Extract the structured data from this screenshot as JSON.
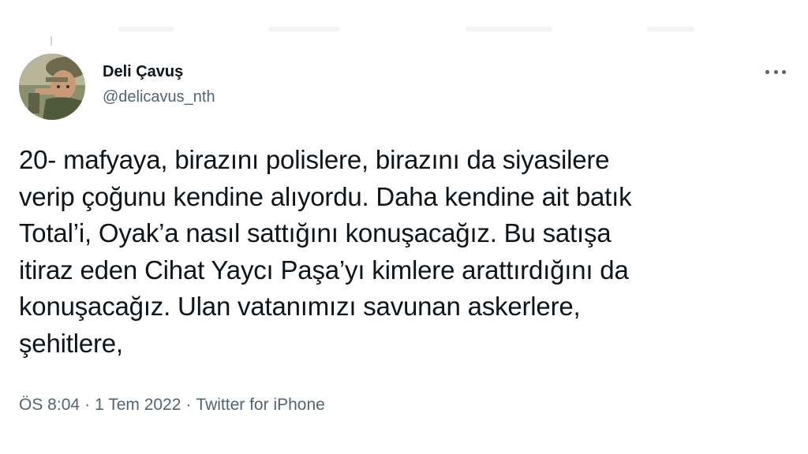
{
  "author": {
    "display_name": "Deli Çavuş",
    "handle": "@delicavus_nth",
    "avatar_icon": "profile-photo"
  },
  "more_menu": {
    "icon": "more-horizontal-icon"
  },
  "tweet": {
    "lines": [
      "20- mafyaya, birazını polislere, birazını da siyasilere",
      "verip çoğunu kendine alıyordu. Daha kendine ait batık",
      "Total’i, Oyak’a nasıl sattığını konuşacağız. Bu satışa",
      "itiraz eden Cihat Yaycı Paşa’yı kimlere arattırdığını da",
      "konuşacağız. Ulan vatanımızı savunan askerlere,",
      "şehitlere,"
    ]
  },
  "meta": {
    "time": "ÖS 8:04",
    "separator": "·",
    "date": "1 Tem 2022",
    "source": "Twitter for iPhone"
  },
  "colors": {
    "text_primary": "#0f1419",
    "text_secondary": "#536471",
    "background": "#ffffff"
  }
}
